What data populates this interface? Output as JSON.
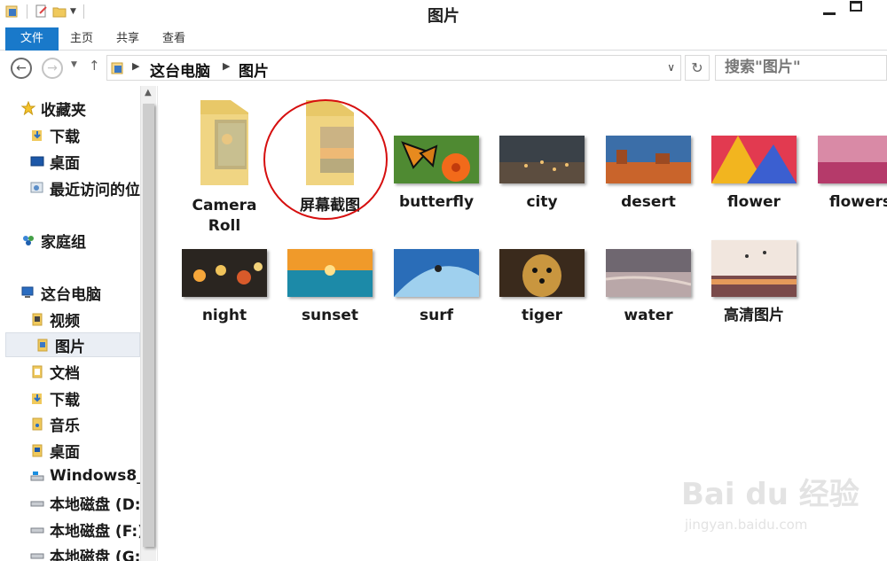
{
  "window": {
    "title": "图片",
    "colors": {
      "accent": "#1979ca",
      "annotation_circle": "#d60f0f"
    }
  },
  "ribbon": {
    "tabs": [
      {
        "label": "文件",
        "active": true
      },
      {
        "label": "主页"
      },
      {
        "label": "共享"
      },
      {
        "label": "查看"
      }
    ]
  },
  "address": {
    "crumbs": [
      "这台电脑",
      "图片"
    ],
    "search_placeholder": "搜索\"图片\""
  },
  "nav_pane": {
    "items": [
      {
        "label": "收藏夹",
        "icon": "star-icon"
      },
      {
        "label": "下载",
        "icon": "download-folder-icon"
      },
      {
        "label": "桌面",
        "icon": "desktop-icon"
      },
      {
        "label": "最近访问的位",
        "icon": "recent-places-icon"
      },
      {
        "label": "家庭组",
        "icon": "homegroup-icon"
      },
      {
        "label": "这台电脑",
        "icon": "this-pc-icon"
      },
      {
        "label": "视频",
        "icon": "videos-folder-icon"
      },
      {
        "label": "图片",
        "icon": "pictures-folder-icon",
        "selected": true
      },
      {
        "label": "文档",
        "icon": "documents-folder-icon"
      },
      {
        "label": "下载",
        "icon": "download-folder-icon"
      },
      {
        "label": "音乐",
        "icon": "music-folder-icon"
      },
      {
        "label": "桌面",
        "icon": "desktop-folder-icon"
      },
      {
        "label": "Windows8_",
        "icon": "system-drive-icon"
      },
      {
        "label": "本地磁盘 (D:",
        "icon": "drive-icon"
      },
      {
        "label": "本地磁盘 (F:)",
        "icon": "drive-icon"
      },
      {
        "label": "本地磁盘 (G:",
        "icon": "drive-icon"
      }
    ]
  },
  "content": {
    "items": [
      {
        "label": "Camera\nRoll",
        "type": "folder"
      },
      {
        "label": "屏幕截图",
        "type": "folder",
        "annotated": true
      },
      {
        "label": "butterfly",
        "type": "image"
      },
      {
        "label": "city",
        "type": "image"
      },
      {
        "label": "desert",
        "type": "image"
      },
      {
        "label": "flower",
        "type": "image"
      },
      {
        "label": "flowers",
        "type": "image"
      },
      {
        "label": "night",
        "type": "image"
      },
      {
        "label": "sunset",
        "type": "image"
      },
      {
        "label": "surf",
        "type": "image"
      },
      {
        "label": "tiger",
        "type": "image"
      },
      {
        "label": "water",
        "type": "image"
      },
      {
        "label": "高清图片",
        "type": "image"
      }
    ]
  },
  "watermark": {
    "brand": "Bai du 经验",
    "url": "jingyan.baidu.com"
  }
}
